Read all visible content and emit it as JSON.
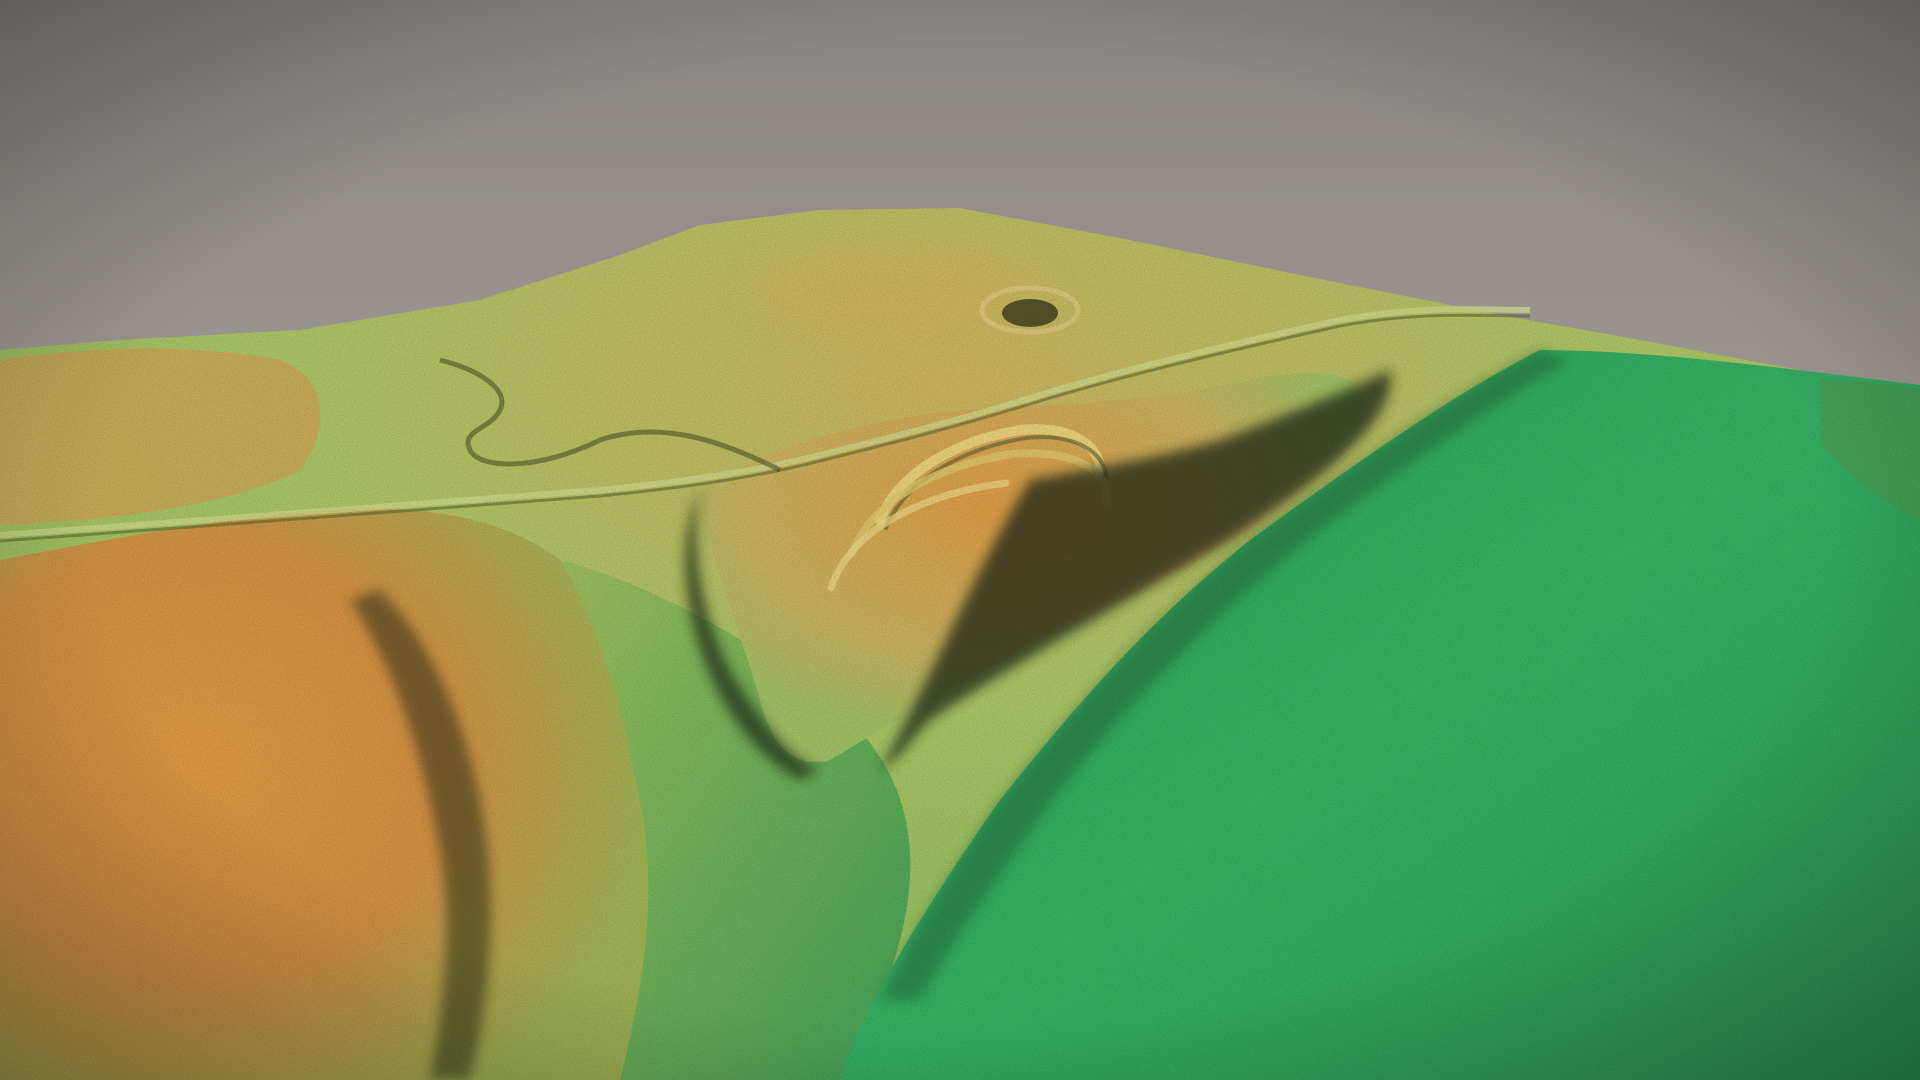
{
  "scene": {
    "subject": "lidar-terrain-model",
    "colors": {
      "sky_top": "#8a8683",
      "sky_mid": "#a49d96",
      "sky_bottom": "#9e9a96",
      "plain": "#35ad63",
      "plain_dark": "#1f7a45",
      "hill_orange": "#d9903f",
      "hill_yellow": "#c9c76a",
      "slope_green": "#8fbf5a",
      "shadow": "#1c2414"
    },
    "vignette": true
  }
}
